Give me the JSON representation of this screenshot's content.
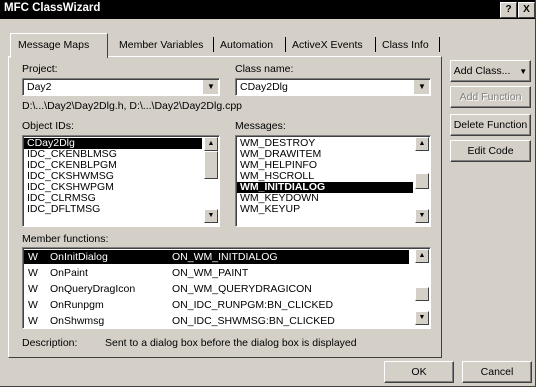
{
  "window": {
    "title": "MFC ClassWizard",
    "help_label": "?",
    "close_label": "X"
  },
  "tabs": [
    {
      "label": "Message Maps",
      "selected": true
    },
    {
      "label": "Member Variables",
      "selected": false
    },
    {
      "label": "Automation",
      "selected": false
    },
    {
      "label": "ActiveX Events",
      "selected": false
    },
    {
      "label": "Class Info",
      "selected": false
    }
  ],
  "project": {
    "label": "Project:",
    "value": "Day2"
  },
  "class_name": {
    "label": "Class name:",
    "value": "CDay2Dlg"
  },
  "file_path": "D:\\...\\Day2\\Day2Dlg.h, D:\\...\\Day2\\Day2Dlg.cpp",
  "object_ids": {
    "label": "Object IDs:",
    "items": [
      "CDay2Dlg",
      "IDC_CKENBLMSG",
      "IDC_CKENBLPGM",
      "IDC_CKSHWMSG",
      "IDC_CKSHWPGM",
      "IDC_CLRMSG",
      "IDC_DFLTMSG"
    ],
    "selected": "CDay2Dlg"
  },
  "messages": {
    "label": "Messages:",
    "items": [
      "WM_DESTROY",
      "WM_DRAWITEM",
      "WM_HELPINFO",
      "WM_HSCROLL",
      "WM_INITDIALOG",
      "WM_KEYDOWN",
      "WM_KEYUP"
    ],
    "selected": "WM_INITDIALOG"
  },
  "member_functions": {
    "label": "Member functions:",
    "rows": [
      {
        "kind": "W",
        "name": "OnInitDialog",
        "handler": "ON_WM_INITDIALOG",
        "selected": true
      },
      {
        "kind": "W",
        "name": "OnPaint",
        "handler": "ON_WM_PAINT",
        "selected": false
      },
      {
        "kind": "W",
        "name": "OnQueryDragIcon",
        "handler": "ON_WM_QUERYDRAGICON",
        "selected": false
      },
      {
        "kind": "W",
        "name": "OnRunpgm",
        "handler": "ON_IDC_RUNPGM:BN_CLICKED",
        "selected": false
      },
      {
        "kind": "W",
        "name": "OnShwmsg",
        "handler": "ON_IDC_SHWMSG:BN_CLICKED",
        "selected": false
      }
    ]
  },
  "description": {
    "label": "Description:",
    "text": "Sent to a dialog box before the dialog box is displayed"
  },
  "buttons": {
    "add_class": "Add Class...",
    "add_function": "Add Function",
    "delete_function": "Delete Function",
    "edit_code": "Edit Code",
    "ok": "OK",
    "cancel": "Cancel"
  }
}
